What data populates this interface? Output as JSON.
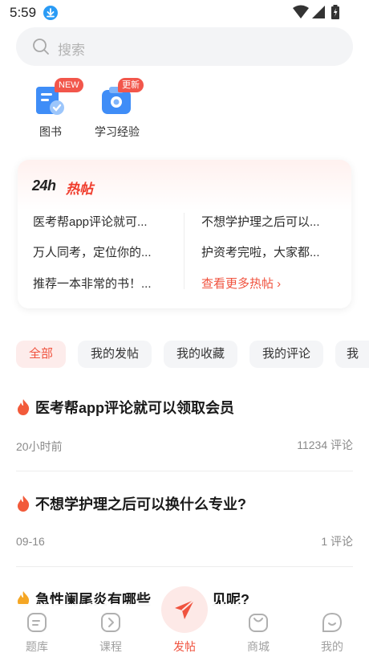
{
  "status_bar": {
    "time": "5:59"
  },
  "search": {
    "placeholder": "搜索"
  },
  "quick_entries": [
    {
      "label": "图书",
      "badge": "NEW",
      "icon": "book-icon"
    },
    {
      "label": "学习经验",
      "badge": "更新",
      "icon": "study-experience-icon"
    }
  ],
  "hot_posts": {
    "title_prefix": "24h",
    "title": "热帖",
    "left": [
      "医考帮app评论就可...",
      "万人同考，定位你的...",
      "推荐一本非常的书！..."
    ],
    "right": [
      "不想学护理之后可以...",
      "护资考完啦，大家都..."
    ],
    "more": "查看更多热帖 ›"
  },
  "tabs": [
    "全部",
    "我的发帖",
    "我的收藏",
    "我的评论",
    "我"
  ],
  "feed": [
    {
      "title": "医考帮app评论就可以领取会员",
      "time": "20小时前",
      "comments": "11234 评论"
    },
    {
      "title": "不想学护理之后可以换什么专业?",
      "time": "09-16",
      "comments": "1 评论"
    },
    {
      "title": "急性阑尾炎有哪些",
      "title_tail": "见呢?"
    }
  ],
  "bottom_nav": [
    {
      "label": "题库",
      "icon": "question-bank-icon"
    },
    {
      "label": "课程",
      "icon": "course-icon"
    },
    {
      "label": "发帖",
      "icon": "paper-plane-icon"
    },
    {
      "label": "商城",
      "icon": "shop-bag-icon"
    },
    {
      "label": "我的",
      "icon": "profile-icon"
    }
  ],
  "colors": {
    "accent": "#f0533f",
    "badge": "#f2564b",
    "download": "#2a9bf5",
    "tab_active_bg": "#fdeceb"
  }
}
